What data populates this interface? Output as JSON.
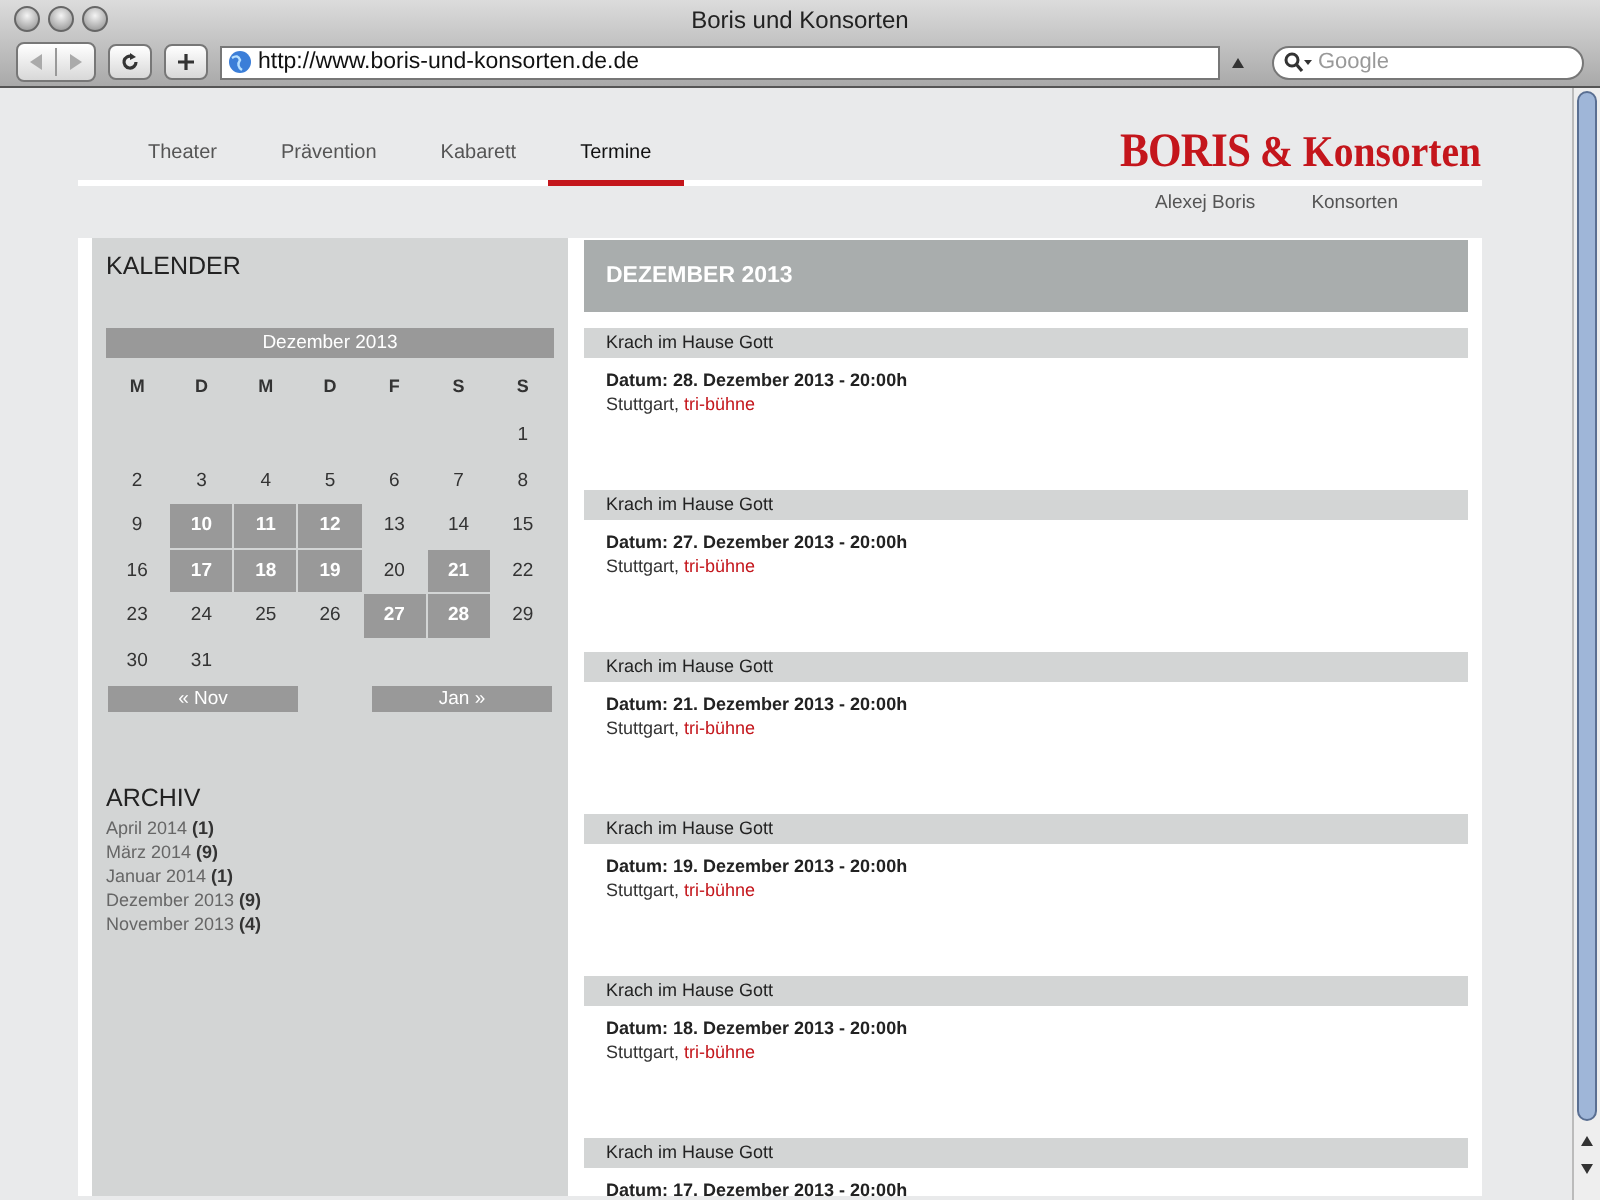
{
  "window": {
    "title": "Boris und Konsorten"
  },
  "toolbar": {
    "url": "http://www.boris-und-konsorten.de.de",
    "search_placeholder": "Google"
  },
  "nav": [
    {
      "label": "Theater",
      "selected": false
    },
    {
      "label": "Prävention",
      "selected": false
    },
    {
      "label": "Kabarett",
      "selected": false
    },
    {
      "label": "Termine",
      "selected": true
    }
  ],
  "logo": {
    "name": "BORIS",
    "suffix": "& Konsorten"
  },
  "subnav": [
    "Alexej Boris",
    "Konsorten"
  ],
  "calendar": {
    "heading": "KALENDER",
    "month": "Dezember 2013",
    "weekdays": [
      "M",
      "D",
      "M",
      "D",
      "F",
      "S",
      "S"
    ],
    "weeks": [
      [
        {
          "day": "1",
          "event": false
        }
      ],
      [
        {
          "day": "2",
          "event": false
        },
        {
          "day": "3",
          "event": false
        },
        {
          "day": "4",
          "event": false
        },
        {
          "day": "5",
          "event": false
        },
        {
          "day": "6",
          "event": false
        },
        {
          "day": "7",
          "event": false
        },
        {
          "day": "8",
          "event": false
        }
      ],
      [
        {
          "day": "9",
          "event": false
        },
        {
          "day": "10",
          "event": true
        },
        {
          "day": "11",
          "event": true
        },
        {
          "day": "12",
          "event": true
        },
        {
          "day": "13",
          "event": false
        },
        {
          "day": "14",
          "event": false
        },
        {
          "day": "15",
          "event": false
        }
      ],
      [
        {
          "day": "16",
          "event": false
        },
        {
          "day": "17",
          "event": true
        },
        {
          "day": "18",
          "event": true
        },
        {
          "day": "19",
          "event": true
        },
        {
          "day": "20",
          "event": false
        },
        {
          "day": "21",
          "event": true
        },
        {
          "day": "22",
          "event": false
        }
      ],
      [
        {
          "day": "23",
          "event": false
        },
        {
          "day": "24",
          "event": false
        },
        {
          "day": "25",
          "event": false
        },
        {
          "day": "26",
          "event": false
        },
        {
          "day": "27",
          "event": true
        },
        {
          "day": "28",
          "event": true
        },
        {
          "day": "29",
          "event": false
        }
      ],
      [
        {
          "day": "30",
          "event": false
        },
        {
          "day": "31",
          "event": false
        }
      ]
    ],
    "prev": "« Nov",
    "next": "Jan »"
  },
  "archive": {
    "heading": "ARCHIV",
    "items": [
      {
        "label": "April 2014",
        "count": "(1)"
      },
      {
        "label": "März 2014",
        "count": "(9)"
      },
      {
        "label": "Januar 2014",
        "count": "(1)"
      },
      {
        "label": "Dezember 2013",
        "count": "(9)"
      },
      {
        "label": "November 2013",
        "count": "(4)"
      }
    ]
  },
  "main": {
    "heading": "DEZEMBER 2013",
    "events": [
      {
        "title": "Krach im Hause Gott",
        "date": "Datum: 28. Dezember 2013 - 20:00h",
        "city": "Stuttgart,",
        "venue": "tri-bühne"
      },
      {
        "title": "Krach im Hause Gott",
        "date": "Datum: 27. Dezember 2013 - 20:00h",
        "city": "Stuttgart,",
        "venue": "tri-bühne"
      },
      {
        "title": "Krach im Hause Gott",
        "date": "Datum: 21. Dezember 2013 - 20:00h",
        "city": "Stuttgart,",
        "venue": "tri-bühne"
      },
      {
        "title": "Krach im Hause Gott",
        "date": "Datum: 19. Dezember 2013 - 20:00h",
        "city": "Stuttgart,",
        "venue": "tri-bühne"
      },
      {
        "title": "Krach im Hause Gott",
        "date": "Datum: 18. Dezember 2013 - 20:00h",
        "city": "Stuttgart,",
        "venue": "tri-bühne"
      },
      {
        "title": "Krach im Hause Gott",
        "date": "Datum: 17. Dezember 2013 - 20:00h"
      }
    ]
  }
}
